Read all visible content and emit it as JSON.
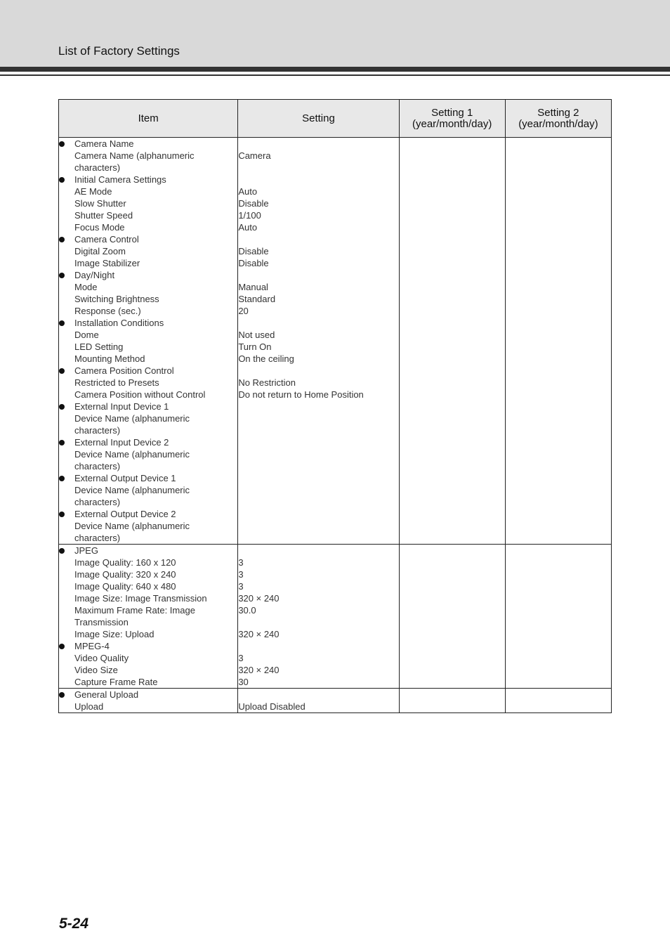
{
  "header": {
    "title": "List of Factory Settings"
  },
  "table": {
    "columns": [
      "Item",
      "Setting",
      "Setting 1\n(year/month/day)",
      "Setting 2\n(year/month/day)"
    ],
    "columns_lines": {
      "item": "Item",
      "setting": "Setting",
      "s1_line1": "Setting 1",
      "s1_line2": "(year/month/day)",
      "s2_line1": "Setting 2",
      "s2_line2": "(year/month/day)"
    },
    "rows": [
      {
        "items": [
          {
            "text": "Camera Name",
            "bullet": true
          },
          {
            "text": "Camera Name (alphanumeric",
            "bullet": false
          },
          {
            "text": "characters)",
            "bullet": false
          },
          {
            "text": "Initial Camera Settings",
            "bullet": true
          },
          {
            "text": "AE Mode",
            "bullet": false
          },
          {
            "text": "Slow Shutter",
            "bullet": false
          },
          {
            "text": "Shutter Speed",
            "bullet": false
          },
          {
            "text": "Focus Mode",
            "bullet": false
          },
          {
            "text": "Camera Control",
            "bullet": true
          },
          {
            "text": "Digital Zoom",
            "bullet": false
          },
          {
            "text": "Image Stabilizer",
            "bullet": false
          },
          {
            "text": "Day/Night",
            "bullet": true
          },
          {
            "text": "Mode",
            "bullet": false
          },
          {
            "text": "Switching Brightness",
            "bullet": false
          },
          {
            "text": "Response (sec.)",
            "bullet": false
          },
          {
            "text": "Installation Conditions",
            "bullet": true
          },
          {
            "text": "Dome",
            "bullet": false
          },
          {
            "text": "LED Setting",
            "bullet": false
          },
          {
            "text": "Mounting Method",
            "bullet": false
          },
          {
            "text": "Camera Position Control",
            "bullet": true
          },
          {
            "text": "Restricted to Presets",
            "bullet": false
          },
          {
            "text": "Camera Position without Control",
            "bullet": false
          },
          {
            "text": "External Input Device 1",
            "bullet": true
          },
          {
            "text": "Device Name (alphanumeric",
            "bullet": false
          },
          {
            "text": "characters)",
            "bullet": false
          },
          {
            "text": "External Input Device 2",
            "bullet": true
          },
          {
            "text": "Device Name (alphanumeric",
            "bullet": false
          },
          {
            "text": "characters)",
            "bullet": false
          },
          {
            "text": "External Output Device 1",
            "bullet": true
          },
          {
            "text": "Device Name (alphanumeric",
            "bullet": false
          },
          {
            "text": "characters)",
            "bullet": false
          },
          {
            "text": "External Output Device 2",
            "bullet": true
          },
          {
            "text": "Device Name (alphanumeric",
            "bullet": false
          },
          {
            "text": "characters)",
            "bullet": false
          }
        ],
        "values": [
          "",
          "Camera",
          "",
          "",
          "Auto",
          "Disable",
          "1/100",
          "Auto",
          "",
          "Disable",
          "Disable",
          "",
          "Manual",
          "Standard",
          "20",
          "",
          "Not used",
          "Turn On",
          "On the ceiling",
          "",
          "No Restriction",
          "Do not return to Home Position"
        ],
        "setting1": "",
        "setting2": ""
      },
      {
        "items": [
          {
            "text": "JPEG",
            "bullet": true
          },
          {
            "text": "Image Quality: 160 x 120",
            "bullet": false
          },
          {
            "text": "Image Quality: 320 x 240",
            "bullet": false
          },
          {
            "text": "Image Quality: 640 x 480",
            "bullet": false
          },
          {
            "text": "Image Size: Image Transmission",
            "bullet": false
          },
          {
            "text": "Maximum Frame Rate: Image",
            "bullet": false
          },
          {
            "text": "Transmission",
            "bullet": false
          },
          {
            "text": "Image Size: Upload",
            "bullet": false
          },
          {
            "text": "MPEG-4",
            "bullet": true
          },
          {
            "text": "Video Quality",
            "bullet": false
          },
          {
            "text": "Video Size",
            "bullet": false
          },
          {
            "text": "Capture Frame Rate",
            "bullet": false
          }
        ],
        "values": [
          "",
          "3",
          "3",
          "3",
          "320 × 240",
          "30.0",
          "",
          "320 × 240",
          "",
          "3",
          "320 × 240",
          "30"
        ],
        "setting1": "",
        "setting2": ""
      },
      {
        "items": [
          {
            "text": "General Upload",
            "bullet": true
          },
          {
            "text": "Upload",
            "bullet": false
          }
        ],
        "values": [
          "",
          "Upload Disabled"
        ],
        "setting1": "",
        "setting2": ""
      }
    ]
  },
  "footer": {
    "page_number": "5-24"
  }
}
